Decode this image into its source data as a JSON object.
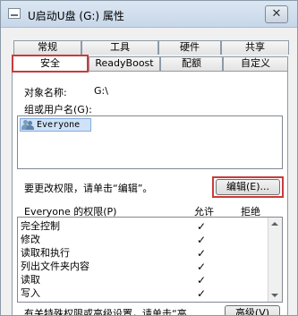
{
  "window": {
    "title": "U启动U盘 (G:) 属性",
    "close_glyph": "✕"
  },
  "tabs": {
    "row1": [
      "常规",
      "工具",
      "硬件",
      "共享"
    ],
    "row2": [
      "安全",
      "ReadyBoost",
      "配额",
      "自定义"
    ],
    "active": "安全"
  },
  "security": {
    "object_label": "对象名称:",
    "object_value": "G:\\",
    "group_label": "组或用户名(G):",
    "users": [
      "Everyone"
    ],
    "edit_hint": "要更改权限，请单击“编辑”。",
    "edit_button": "编辑(E)...",
    "perm_header": "Everyone 的权限(P)",
    "allow_header": "允许",
    "deny_header": "拒绝",
    "permissions": [
      {
        "name": "完全控制",
        "allow": "✓"
      },
      {
        "name": "修改",
        "allow": "✓"
      },
      {
        "name": "读取和执行",
        "allow": "✓"
      },
      {
        "name": "列出文件夹内容",
        "allow": "✓"
      },
      {
        "name": "读取",
        "allow": "✓"
      },
      {
        "name": "写入",
        "allow": "✓"
      }
    ],
    "advanced_hint": "有关特殊权限或高级设置，请单击“高",
    "advanced_button": "高级(V)"
  },
  "colors": {
    "highlight_box": "#c73c3c",
    "selection": "#cfe2f7"
  }
}
